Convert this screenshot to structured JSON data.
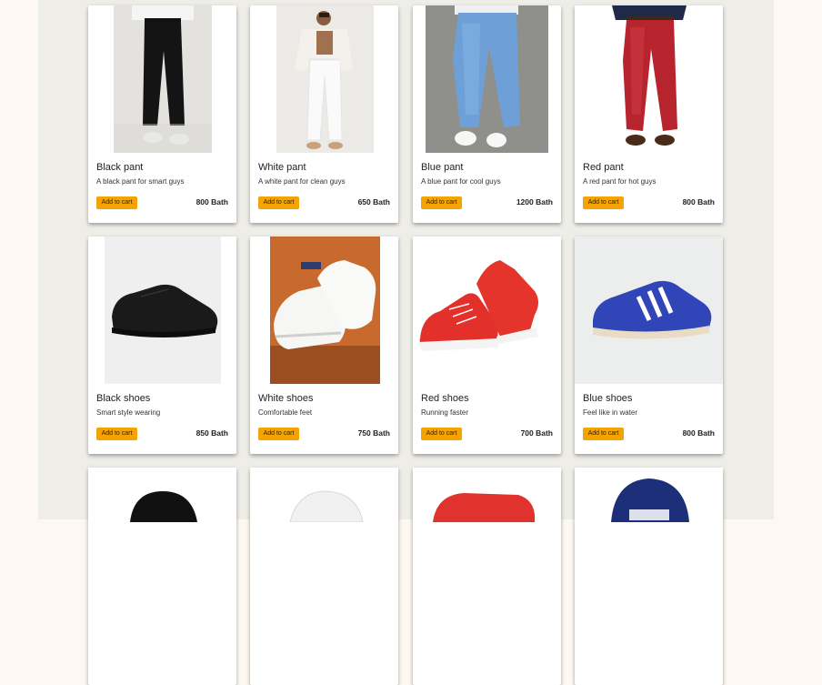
{
  "products": [
    {
      "name": "Black pant",
      "desc": "A black pant for smart guys",
      "button": "Add to cart",
      "price": "800 Bath"
    },
    {
      "name": "White pant",
      "desc": "A white pant for clean guys",
      "button": "Add to cart",
      "price": "650 Bath"
    },
    {
      "name": "Blue pant",
      "desc": "A blue pant for cool guys",
      "button": "Add to cart",
      "price": "1200 Bath"
    },
    {
      "name": "Red pant",
      "desc": "A red pant for hot guys",
      "button": "Add to cart",
      "price": "800 Bath"
    },
    {
      "name": "Black shoes",
      "desc": "Smart style wearing",
      "button": "Add to cart",
      "price": "850 Bath"
    },
    {
      "name": "White shoes",
      "desc": "Comfortable feet",
      "button": "Add to cart",
      "price": "750 Bath"
    },
    {
      "name": "Red shoes",
      "desc": "Running faster",
      "button": "Add to cart",
      "price": "700 Bath"
    },
    {
      "name": "Blue shoes",
      "desc": "Feel like in water",
      "button": "Add to cart",
      "price": "800 Bath"
    }
  ],
  "colors": {
    "button": "#f4a300",
    "page_bg": "#fdf8f1",
    "panel_bg": "#eeede7"
  }
}
